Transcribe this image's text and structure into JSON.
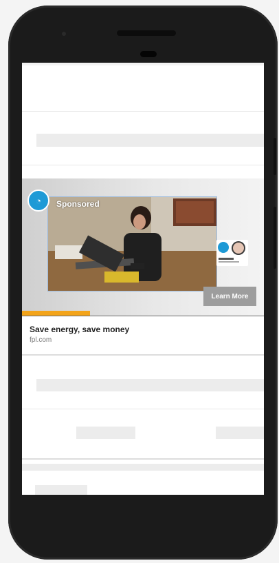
{
  "ad": {
    "sponsored_label": "Sponsored",
    "cta_label": "Learn More",
    "title": "Save energy, save money",
    "domain": "fpl.com",
    "progress_fraction": 0.28,
    "accent_color": "#f3a41a",
    "badge_color": "#1e9ad6"
  }
}
